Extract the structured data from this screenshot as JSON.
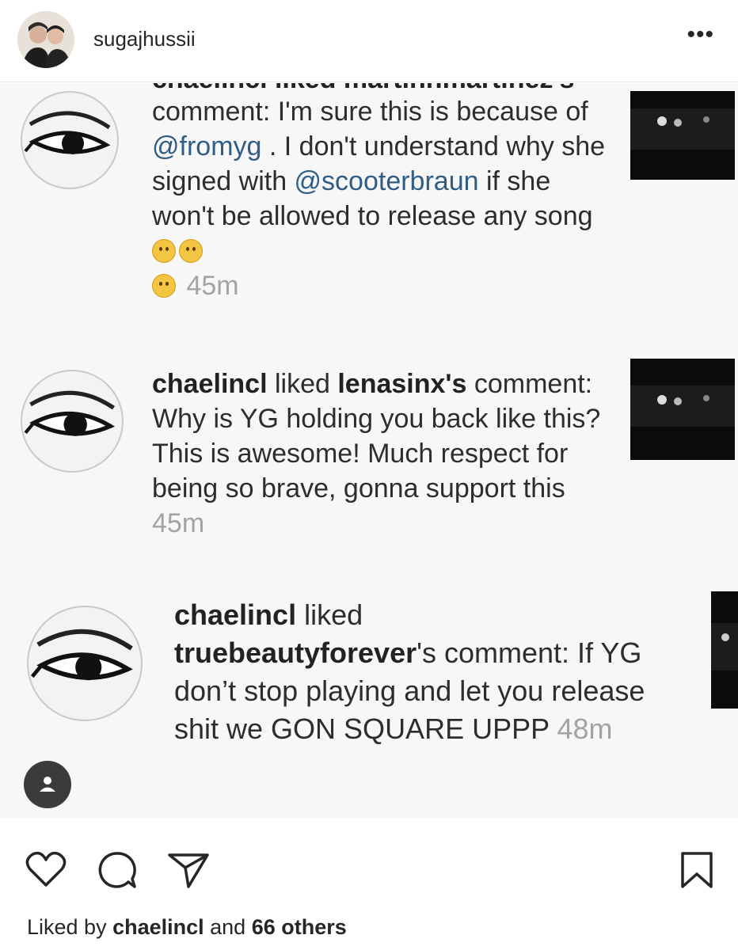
{
  "header": {
    "username": "sugajhussii",
    "more_label": "•••"
  },
  "notifications": [
    {
      "head_cut": "chaelincl liked martinnmartinez's",
      "lines_before": "comment: I'm sure this is because of ",
      "mention1": "@fromyg",
      "mid": " . I don't understand why she signed with ",
      "mention2": "@scooterbraun",
      "after": " if she won't be allowed to release any song",
      "time": "45m"
    },
    {
      "user": "chaelincl",
      "verb": " liked ",
      "target": "lenasinx's",
      "comment": " comment: Why is YG holding you back like this? This is awesome! Much respect for being so brave, gonna support this ",
      "time": "45m"
    },
    {
      "user": "chaelincl",
      "verb": " liked",
      "target": "truebeautyforever",
      "comment_pre": "'s comment: If YG don’t stop playing and let you release shit we GON SQUARE UPPP ",
      "time": "48m"
    }
  ],
  "footer": {
    "liked_by_prefix": "Liked by ",
    "liked_by_user": "chaelincl",
    "liked_by_mid": " and ",
    "liked_by_count": "66 others"
  },
  "colors": {
    "mention": "#2f5d86",
    "time": "#a3a3a3",
    "text": "#262626"
  }
}
